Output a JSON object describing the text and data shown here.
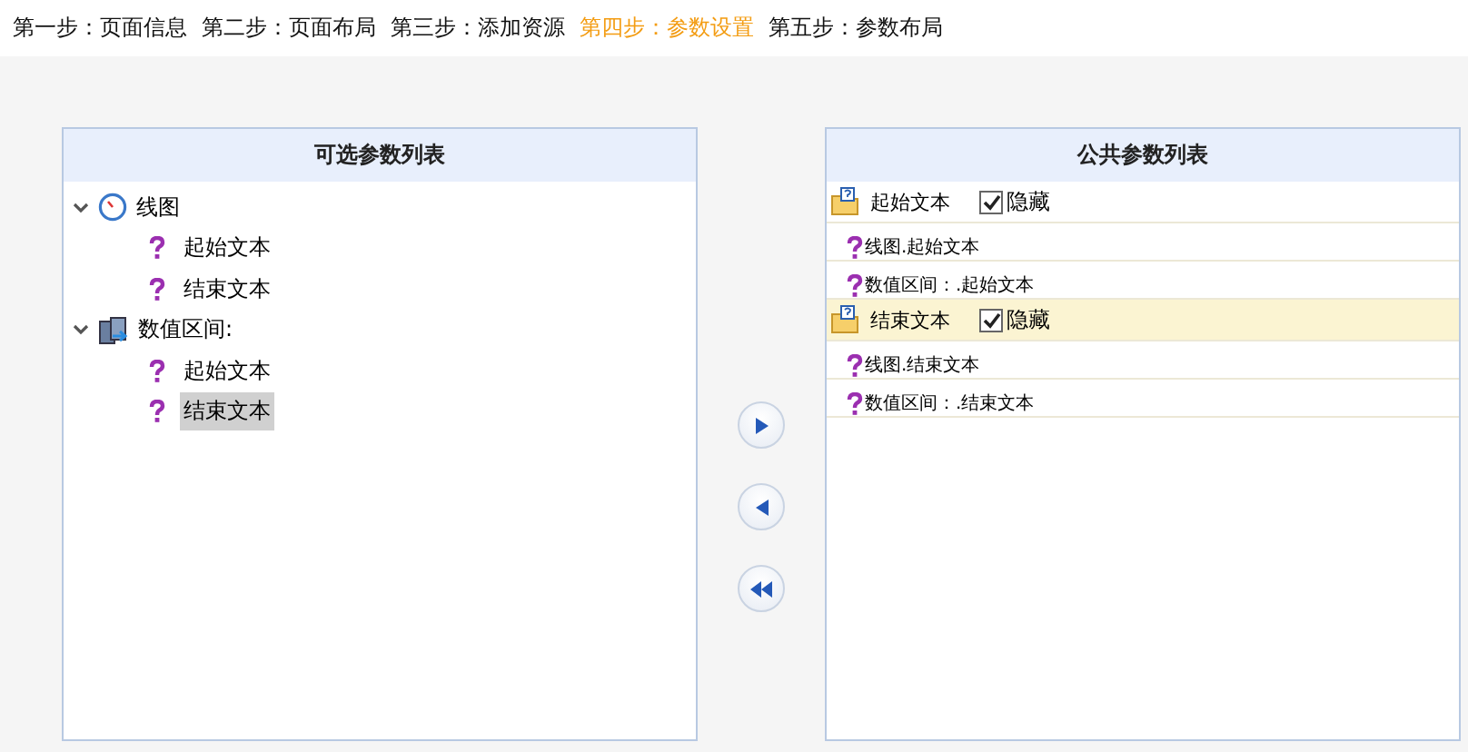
{
  "steps": [
    {
      "label": "第一步：页面信息",
      "selected": false
    },
    {
      "label": "第二步：页面布局",
      "selected": false
    },
    {
      "label": "第三步：添加资源",
      "selected": false
    },
    {
      "label": "第四步：参数设置",
      "selected": true
    },
    {
      "label": "第五步：参数布局",
      "selected": false
    }
  ],
  "available": {
    "title": "可选参数列表",
    "tree": [
      {
        "label": "线图",
        "kind": "chart",
        "expanded": true,
        "children": [
          {
            "label": "起始文本",
            "selected": false
          },
          {
            "label": "结束文本",
            "selected": false
          }
        ]
      },
      {
        "label": "数值区间:",
        "kind": "range",
        "expanded": true,
        "children": [
          {
            "label": "起始文本",
            "selected": false
          },
          {
            "label": "结束文本",
            "selected": true
          }
        ]
      }
    ]
  },
  "actions": [
    {
      "kind": "add"
    },
    {
      "kind": "remove"
    },
    {
      "kind": "remove_all"
    }
  ],
  "common": {
    "title": "公共参数列表",
    "groups": [
      {
        "label": "起始文本",
        "hide_label": "隐藏",
        "hidden": true,
        "selected": false,
        "children": [
          "线图.起始文本",
          "数值区间：.起始文本"
        ]
      },
      {
        "label": "结束文本",
        "hide_label": "隐藏",
        "hidden": true,
        "selected": true,
        "children": [
          "线图.结束文本",
          "数值区间：.结束文本"
        ]
      }
    ]
  }
}
